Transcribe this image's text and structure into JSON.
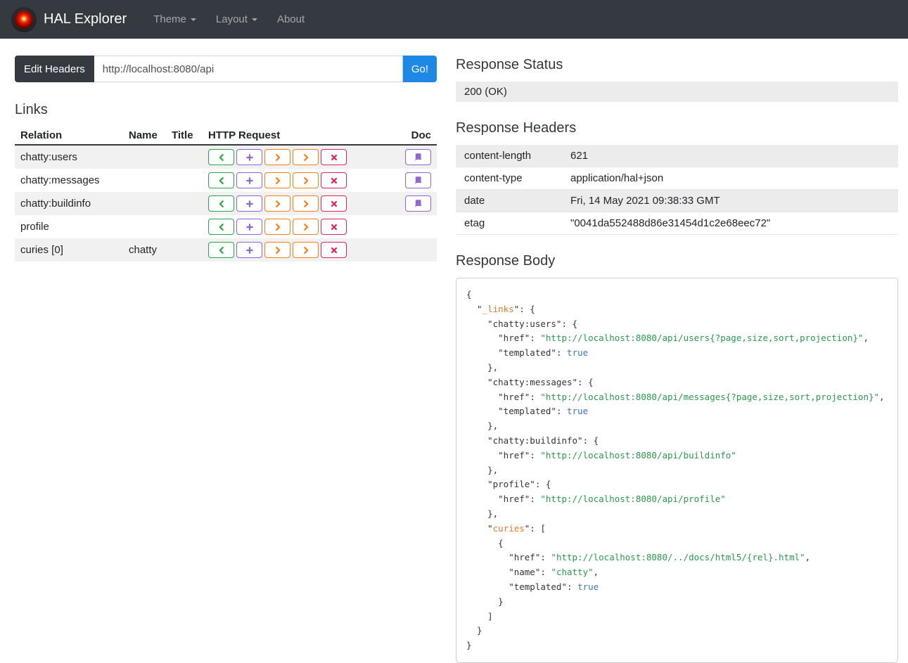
{
  "navbar": {
    "brand": "HAL Explorer",
    "logo": "hal-9000-eye-icon",
    "items": [
      {
        "label": "Theme",
        "caret": true
      },
      {
        "label": "Layout",
        "caret": true
      },
      {
        "label": "About",
        "caret": false
      }
    ]
  },
  "request_bar": {
    "edit_headers_label": "Edit Headers",
    "url_value": "http://localhost:8080/api",
    "go_label": "Go!"
  },
  "links": {
    "title": "Links",
    "columns": [
      "Relation",
      "Name",
      "Title",
      "HTTP Request",
      "Doc"
    ],
    "http_buttons": [
      {
        "name": "get",
        "icon": "chevron-left-icon",
        "color": "#28a745"
      },
      {
        "name": "post",
        "icon": "plus-icon",
        "color": "#9664d2"
      },
      {
        "name": "put",
        "icon": "chevron-right-icon",
        "color": "#fd7e14"
      },
      {
        "name": "patch",
        "icon": "chevron-right-icon",
        "color": "#fd7e14"
      },
      {
        "name": "delete",
        "icon": "x-icon",
        "color": "#e0245e"
      }
    ],
    "doc_button": {
      "icon": "book-icon",
      "color": "#9664d2"
    },
    "rows": [
      {
        "relation": "chatty:users",
        "name": "",
        "title": "",
        "doc": true
      },
      {
        "relation": "chatty:messages",
        "name": "",
        "title": "",
        "doc": true
      },
      {
        "relation": "chatty:buildinfo",
        "name": "",
        "title": "",
        "doc": true
      },
      {
        "relation": "profile",
        "name": "",
        "title": "",
        "doc": false
      },
      {
        "relation": "curies [0]",
        "name": "chatty",
        "title": "",
        "doc": false
      }
    ]
  },
  "response_status": {
    "title": "Response Status",
    "value": "200 (OK)"
  },
  "response_headers": {
    "title": "Response Headers",
    "rows": [
      {
        "key": "content-length",
        "value": "621"
      },
      {
        "key": "content-type",
        "value": "application/hal+json"
      },
      {
        "key": "date",
        "value": "Fri, 14 May 2021 09:38:33 GMT"
      },
      {
        "key": "etag",
        "value": "\"0041da552488d86e31454d1c2e68eec72\""
      }
    ]
  },
  "response_body": {
    "title": "Response Body",
    "lines": [
      [
        [
          "p",
          "{"
        ]
      ],
      [
        [
          "p",
          "  \""
        ],
        [
          "lk",
          "_links"
        ],
        [
          "p",
          "\": {"
        ]
      ],
      [
        [
          "k",
          "    \"chatty:users\""
        ],
        [
          "p",
          ": {"
        ]
      ],
      [
        [
          "k",
          "      \"href\""
        ],
        [
          "p",
          ": "
        ],
        [
          "s",
          "\"http://localhost:8080/api/users{?page,size,sort,projection}\""
        ],
        [
          "p",
          ","
        ]
      ],
      [
        [
          "k",
          "      \"templated\""
        ],
        [
          "p",
          ": "
        ],
        [
          "b",
          "true"
        ]
      ],
      [
        [
          "p",
          "    },"
        ]
      ],
      [
        [
          "k",
          "    \"chatty:messages\""
        ],
        [
          "p",
          ": {"
        ]
      ],
      [
        [
          "k",
          "      \"href\""
        ],
        [
          "p",
          ": "
        ],
        [
          "s",
          "\"http://localhost:8080/api/messages{?page,size,sort,projection}\""
        ],
        [
          "p",
          ","
        ]
      ],
      [
        [
          "k",
          "      \"templated\""
        ],
        [
          "p",
          ": "
        ],
        [
          "b",
          "true"
        ]
      ],
      [
        [
          "p",
          "    },"
        ]
      ],
      [
        [
          "k",
          "    \"chatty:buildinfo\""
        ],
        [
          "p",
          ": {"
        ]
      ],
      [
        [
          "k",
          "      \"href\""
        ],
        [
          "p",
          ": "
        ],
        [
          "s",
          "\"http://localhost:8080/api/buildinfo\""
        ]
      ],
      [
        [
          "p",
          "    },"
        ]
      ],
      [
        [
          "k",
          "    \"profile\""
        ],
        [
          "p",
          ": {"
        ]
      ],
      [
        [
          "k",
          "      \"href\""
        ],
        [
          "p",
          ": "
        ],
        [
          "s",
          "\"http://localhost:8080/api/profile\""
        ]
      ],
      [
        [
          "p",
          "    },"
        ]
      ],
      [
        [
          "p",
          "    \""
        ],
        [
          "lk",
          "curies"
        ],
        [
          "p",
          "\": ["
        ]
      ],
      [
        [
          "p",
          "      {"
        ]
      ],
      [
        [
          "k",
          "        \"href\""
        ],
        [
          "p",
          ": "
        ],
        [
          "s",
          "\"http://localhost:8080/../docs/html5/{rel}.html\""
        ],
        [
          "p",
          ","
        ]
      ],
      [
        [
          "k",
          "        \"name\""
        ],
        [
          "p",
          ": "
        ],
        [
          "s",
          "\"chatty\""
        ],
        [
          "p",
          ","
        ]
      ],
      [
        [
          "k",
          "        \"templated\""
        ],
        [
          "p",
          ": "
        ],
        [
          "b",
          "true"
        ]
      ],
      [
        [
          "p",
          "      }"
        ]
      ],
      [
        [
          "p",
          "    ]"
        ]
      ],
      [
        [
          "p",
          "  }"
        ]
      ],
      [
        [
          "p",
          "}"
        ]
      ]
    ]
  },
  "colors": {
    "navbar_bg": "#343a40",
    "go_button_blue": "#1e88e5",
    "get_green": "#28a745",
    "post_purple": "#9664d2",
    "put_patch_orange": "#fd7e14",
    "delete_red": "#e0245e",
    "doc_purple": "#9664d2",
    "json_link_key_orange": "#e8782a",
    "json_string_green": "#289a4c",
    "json_literal_blue": "#3b77b5"
  }
}
